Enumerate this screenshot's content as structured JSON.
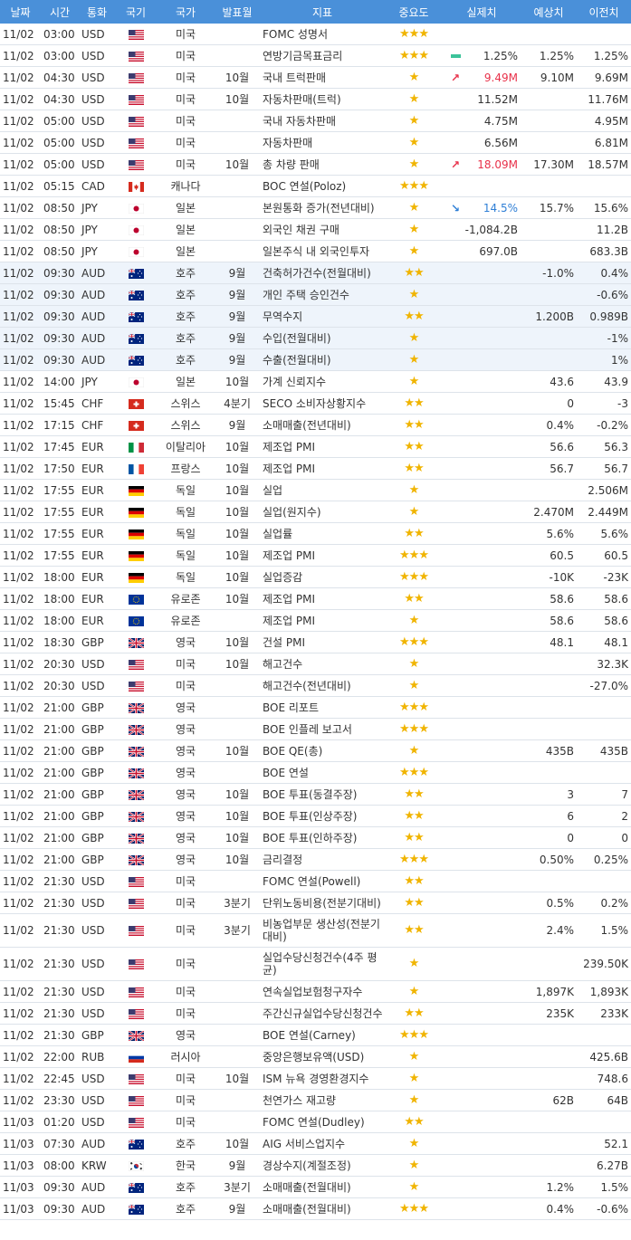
{
  "headers": [
    "날짜",
    "시간",
    "통화",
    "국기",
    "국가",
    "발표월",
    "지표",
    "중요도",
    "실제치",
    "예상치",
    "이전치"
  ],
  "colors": {
    "header": "#4a90d9",
    "star": "#f0b400",
    "up": "#e8314a",
    "down": "#2f7fd6",
    "flat": "#3cc39a"
  },
  "rows": [
    {
      "date": "11/02",
      "time": "03:00",
      "cur": "USD",
      "flag": "us-flag",
      "country": "미국",
      "month": "",
      "indicator": "FOMC 성명서",
      "stars": "★★★",
      "trend": "",
      "actual": "",
      "forecast": "",
      "previous": ""
    },
    {
      "date": "11/02",
      "time": "03:00",
      "cur": "USD",
      "flag": "us-flag",
      "country": "미국",
      "month": "",
      "indicator": "연방기금목표금리",
      "stars": "★★★",
      "trend": "flat",
      "actual": "1.25%",
      "forecast": "1.25%",
      "previous": "1.25%"
    },
    {
      "date": "11/02",
      "time": "04:30",
      "cur": "USD",
      "flag": "us-flag",
      "country": "미국",
      "month": "10월",
      "indicator": "국내 트럭판매",
      "stars": "★",
      "trend": "up",
      "actual": "9.49M",
      "forecast": "9.10M",
      "previous": "9.69M"
    },
    {
      "date": "11/02",
      "time": "04:30",
      "cur": "USD",
      "flag": "us-flag",
      "country": "미국",
      "month": "10월",
      "indicator": "자동차판매(트럭)",
      "stars": "★",
      "trend": "",
      "actual": "11.52M",
      "forecast": "",
      "previous": "11.76M"
    },
    {
      "date": "11/02",
      "time": "05:00",
      "cur": "USD",
      "flag": "us-flag",
      "country": "미국",
      "month": "",
      "indicator": "국내 자동차판매",
      "stars": "★",
      "trend": "",
      "actual": "4.75M",
      "forecast": "",
      "previous": "4.95M"
    },
    {
      "date": "11/02",
      "time": "05:00",
      "cur": "USD",
      "flag": "us-flag",
      "country": "미국",
      "month": "",
      "indicator": "자동차판매",
      "stars": "★",
      "trend": "",
      "actual": "6.56M",
      "forecast": "",
      "previous": "6.81M"
    },
    {
      "date": "11/02",
      "time": "05:00",
      "cur": "USD",
      "flag": "us-flag",
      "country": "미국",
      "month": "10월",
      "indicator": "총 차량 판매",
      "stars": "★",
      "trend": "up",
      "actual": "18.09M",
      "forecast": "17.30M",
      "previous": "18.57M"
    },
    {
      "date": "11/02",
      "time": "05:15",
      "cur": "CAD",
      "flag": "ca-flag",
      "country": "캐나다",
      "month": "",
      "indicator": "BOC 연설(Poloz)",
      "stars": "★★★",
      "trend": "",
      "actual": "",
      "forecast": "",
      "previous": ""
    },
    {
      "date": "11/02",
      "time": "08:50",
      "cur": "JPY",
      "flag": "jp-flag",
      "country": "일본",
      "month": "",
      "indicator": "본원통화 증가(전년대비)",
      "stars": "★",
      "trend": "down",
      "actual": "14.5%",
      "forecast": "15.7%",
      "previous": "15.6%"
    },
    {
      "date": "11/02",
      "time": "08:50",
      "cur": "JPY",
      "flag": "jp-flag",
      "country": "일본",
      "month": "",
      "indicator": "외국인 채권 구매",
      "stars": "★",
      "trend": "",
      "actual": "-1,084.2B",
      "forecast": "",
      "previous": "11.2B"
    },
    {
      "date": "11/02",
      "time": "08:50",
      "cur": "JPY",
      "flag": "jp-flag",
      "country": "일본",
      "month": "",
      "indicator": "일본주식 내 외국인투자",
      "stars": "★",
      "trend": "",
      "actual": "697.0B",
      "forecast": "",
      "previous": "683.3B"
    },
    {
      "date": "11/02",
      "time": "09:30",
      "cur": "AUD",
      "flag": "au-flag",
      "country": "호주",
      "month": "9월",
      "indicator": "건축허가건수(전월대비)",
      "stars": "★★",
      "trend": "",
      "actual": "",
      "forecast": "-1.0%",
      "previous": "0.4%",
      "hl": true
    },
    {
      "date": "11/02",
      "time": "09:30",
      "cur": "AUD",
      "flag": "au-flag",
      "country": "호주",
      "month": "9월",
      "indicator": "개인 주택 승인건수",
      "stars": "★",
      "trend": "",
      "actual": "",
      "forecast": "",
      "previous": "-0.6%",
      "hl": true
    },
    {
      "date": "11/02",
      "time": "09:30",
      "cur": "AUD",
      "flag": "au-flag",
      "country": "호주",
      "month": "9월",
      "indicator": "무역수지",
      "stars": "★★",
      "trend": "",
      "actual": "",
      "forecast": "1.200B",
      "previous": "0.989B",
      "hl": true
    },
    {
      "date": "11/02",
      "time": "09:30",
      "cur": "AUD",
      "flag": "au-flag",
      "country": "호주",
      "month": "9월",
      "indicator": "수입(전월대비)",
      "stars": "★",
      "trend": "",
      "actual": "",
      "forecast": "",
      "previous": "-1%",
      "hl": true
    },
    {
      "date": "11/02",
      "time": "09:30",
      "cur": "AUD",
      "flag": "au-flag",
      "country": "호주",
      "month": "9월",
      "indicator": "수출(전월대비)",
      "stars": "★",
      "trend": "",
      "actual": "",
      "forecast": "",
      "previous": "1%",
      "hl": true
    },
    {
      "date": "11/02",
      "time": "14:00",
      "cur": "JPY",
      "flag": "jp-flag",
      "country": "일본",
      "month": "10월",
      "indicator": "가계 신뢰지수",
      "stars": "★",
      "trend": "",
      "actual": "",
      "forecast": "43.6",
      "previous": "43.9"
    },
    {
      "date": "11/02",
      "time": "15:45",
      "cur": "CHF",
      "flag": "ch-flag",
      "country": "스위스",
      "month": "4분기",
      "indicator": "SECO 소비자상황지수",
      "stars": "★★",
      "trend": "",
      "actual": "",
      "forecast": "0",
      "previous": "-3"
    },
    {
      "date": "11/02",
      "time": "17:15",
      "cur": "CHF",
      "flag": "ch-flag",
      "country": "스위스",
      "month": "9월",
      "indicator": "소매매출(전년대비)",
      "stars": "★★",
      "trend": "",
      "actual": "",
      "forecast": "0.4%",
      "previous": "-0.2%"
    },
    {
      "date": "11/02",
      "time": "17:45",
      "cur": "EUR",
      "flag": "it-flag",
      "country": "이탈리아",
      "month": "10월",
      "indicator": "제조업 PMI",
      "stars": "★★",
      "trend": "",
      "actual": "",
      "forecast": "56.6",
      "previous": "56.3"
    },
    {
      "date": "11/02",
      "time": "17:50",
      "cur": "EUR",
      "flag": "fr-flag",
      "country": "프랑스",
      "month": "10월",
      "indicator": "제조업 PMI",
      "stars": "★★",
      "trend": "",
      "actual": "",
      "forecast": "56.7",
      "previous": "56.7"
    },
    {
      "date": "11/02",
      "time": "17:55",
      "cur": "EUR",
      "flag": "de-flag",
      "country": "독일",
      "month": "10월",
      "indicator": "실업",
      "stars": "★",
      "trend": "",
      "actual": "",
      "forecast": "",
      "previous": "2.506M"
    },
    {
      "date": "11/02",
      "time": "17:55",
      "cur": "EUR",
      "flag": "de-flag",
      "country": "독일",
      "month": "10월",
      "indicator": "실업(원지수)",
      "stars": "★",
      "trend": "",
      "actual": "",
      "forecast": "2.470M",
      "previous": "2.449M"
    },
    {
      "date": "11/02",
      "time": "17:55",
      "cur": "EUR",
      "flag": "de-flag",
      "country": "독일",
      "month": "10월",
      "indicator": "실업률",
      "stars": "★★",
      "trend": "",
      "actual": "",
      "forecast": "5.6%",
      "previous": "5.6%"
    },
    {
      "date": "11/02",
      "time": "17:55",
      "cur": "EUR",
      "flag": "de-flag",
      "country": "독일",
      "month": "10월",
      "indicator": "제조업 PMI",
      "stars": "★★★",
      "trend": "",
      "actual": "",
      "forecast": "60.5",
      "previous": "60.5"
    },
    {
      "date": "11/02",
      "time": "18:00",
      "cur": "EUR",
      "flag": "de-flag",
      "country": "독일",
      "month": "10월",
      "indicator": "실업증감",
      "stars": "★★★",
      "trend": "",
      "actual": "",
      "forecast": "-10K",
      "previous": "-23K"
    },
    {
      "date": "11/02",
      "time": "18:00",
      "cur": "EUR",
      "flag": "eu-flag",
      "country": "유로존",
      "month": "10월",
      "indicator": "제조업 PMI",
      "stars": "★★",
      "trend": "",
      "actual": "",
      "forecast": "58.6",
      "previous": "58.6"
    },
    {
      "date": "11/02",
      "time": "18:00",
      "cur": "EUR",
      "flag": "eu-flag",
      "country": "유로존",
      "month": "",
      "indicator": "제조업 PMI",
      "stars": "★",
      "trend": "",
      "actual": "",
      "forecast": "58.6",
      "previous": "58.6"
    },
    {
      "date": "11/02",
      "time": "18:30",
      "cur": "GBP",
      "flag": "gb-flag",
      "country": "영국",
      "month": "10월",
      "indicator": "건설 PMI",
      "stars": "★★★",
      "trend": "",
      "actual": "",
      "forecast": "48.1",
      "previous": "48.1"
    },
    {
      "date": "11/02",
      "time": "20:30",
      "cur": "USD",
      "flag": "us-flag",
      "country": "미국",
      "month": "10월",
      "indicator": "해고건수",
      "stars": "★",
      "trend": "",
      "actual": "",
      "forecast": "",
      "previous": "32.3K"
    },
    {
      "date": "11/02",
      "time": "20:30",
      "cur": "USD",
      "flag": "us-flag",
      "country": "미국",
      "month": "",
      "indicator": "해고건수(전년대비)",
      "stars": "★",
      "trend": "",
      "actual": "",
      "forecast": "",
      "previous": "-27.0%"
    },
    {
      "date": "11/02",
      "time": "21:00",
      "cur": "GBP",
      "flag": "gb-flag",
      "country": "영국",
      "month": "",
      "indicator": "BOE 리포트",
      "stars": "★★★",
      "trend": "",
      "actual": "",
      "forecast": "",
      "previous": ""
    },
    {
      "date": "11/02",
      "time": "21:00",
      "cur": "GBP",
      "flag": "gb-flag",
      "country": "영국",
      "month": "",
      "indicator": "BOE 인플레 보고서",
      "stars": "★★★",
      "trend": "",
      "actual": "",
      "forecast": "",
      "previous": ""
    },
    {
      "date": "11/02",
      "time": "21:00",
      "cur": "GBP",
      "flag": "gb-flag",
      "country": "영국",
      "month": "10월",
      "indicator": "BOE QE(총)",
      "stars": "★",
      "trend": "",
      "actual": "",
      "forecast": "435B",
      "previous": "435B"
    },
    {
      "date": "11/02",
      "time": "21:00",
      "cur": "GBP",
      "flag": "gb-flag",
      "country": "영국",
      "month": "",
      "indicator": "BOE 연설",
      "stars": "★★★",
      "trend": "",
      "actual": "",
      "forecast": "",
      "previous": ""
    },
    {
      "date": "11/02",
      "time": "21:00",
      "cur": "GBP",
      "flag": "gb-flag",
      "country": "영국",
      "month": "10월",
      "indicator": "BOE 투표(동결주장)",
      "stars": "★★",
      "trend": "",
      "actual": "",
      "forecast": "3",
      "previous": "7"
    },
    {
      "date": "11/02",
      "time": "21:00",
      "cur": "GBP",
      "flag": "gb-flag",
      "country": "영국",
      "month": "10월",
      "indicator": "BOE 투표(인상주장)",
      "stars": "★★",
      "trend": "",
      "actual": "",
      "forecast": "6",
      "previous": "2"
    },
    {
      "date": "11/02",
      "time": "21:00",
      "cur": "GBP",
      "flag": "gb-flag",
      "country": "영국",
      "month": "10월",
      "indicator": "BOE 투표(인하주장)",
      "stars": "★★",
      "trend": "",
      "actual": "",
      "forecast": "0",
      "previous": "0"
    },
    {
      "date": "11/02",
      "time": "21:00",
      "cur": "GBP",
      "flag": "gb-flag",
      "country": "영국",
      "month": "10월",
      "indicator": "금리결정",
      "stars": "★★★",
      "trend": "",
      "actual": "",
      "forecast": "0.50%",
      "previous": "0.25%"
    },
    {
      "date": "11/02",
      "time": "21:30",
      "cur": "USD",
      "flag": "us-flag",
      "country": "미국",
      "month": "",
      "indicator": "FOMC 연설(Powell)",
      "stars": "★★",
      "trend": "",
      "actual": "",
      "forecast": "",
      "previous": ""
    },
    {
      "date": "11/02",
      "time": "21:30",
      "cur": "USD",
      "flag": "us-flag",
      "country": "미국",
      "month": "3분기",
      "indicator": "단위노동비용(전분기대비)",
      "stars": "★★",
      "trend": "",
      "actual": "",
      "forecast": "0.5%",
      "previous": "0.2%"
    },
    {
      "date": "11/02",
      "time": "21:30",
      "cur": "USD",
      "flag": "us-flag",
      "country": "미국",
      "month": "3분기",
      "indicator": "비농업부문 생산성(전분기대비)",
      "stars": "★★",
      "trend": "",
      "actual": "",
      "forecast": "2.4%",
      "previous": "1.5%",
      "tall": true
    },
    {
      "date": "11/02",
      "time": "21:30",
      "cur": "USD",
      "flag": "us-flag",
      "country": "미국",
      "month": "",
      "indicator": "실업수당신청건수(4주 평균)",
      "stars": "★",
      "trend": "",
      "actual": "",
      "forecast": "",
      "previous": "239.50K",
      "tall": true
    },
    {
      "date": "11/02",
      "time": "21:30",
      "cur": "USD",
      "flag": "us-flag",
      "country": "미국",
      "month": "",
      "indicator": "연속실업보험청구자수",
      "stars": "★",
      "trend": "",
      "actual": "",
      "forecast": "1,897K",
      "previous": "1,893K"
    },
    {
      "date": "11/02",
      "time": "21:30",
      "cur": "USD",
      "flag": "us-flag",
      "country": "미국",
      "month": "",
      "indicator": "주간신규실업수당신청건수",
      "stars": "★★",
      "trend": "",
      "actual": "",
      "forecast": "235K",
      "previous": "233K"
    },
    {
      "date": "11/02",
      "time": "21:30",
      "cur": "GBP",
      "flag": "gb-flag",
      "country": "영국",
      "month": "",
      "indicator": "BOE 연설(Carney)",
      "stars": "★★★",
      "trend": "",
      "actual": "",
      "forecast": "",
      "previous": ""
    },
    {
      "date": "11/02",
      "time": "22:00",
      "cur": "RUB",
      "flag": "ru-flag",
      "country": "러시아",
      "month": "",
      "indicator": "중앙은행보유액(USD)",
      "stars": "★",
      "trend": "",
      "actual": "",
      "forecast": "",
      "previous": "425.6B"
    },
    {
      "date": "11/02",
      "time": "22:45",
      "cur": "USD",
      "flag": "us-flag",
      "country": "미국",
      "month": "10월",
      "indicator": "ISM 뉴욕 경영환경지수",
      "stars": "★",
      "trend": "",
      "actual": "",
      "forecast": "",
      "previous": "748.6"
    },
    {
      "date": "11/02",
      "time": "23:30",
      "cur": "USD",
      "flag": "us-flag",
      "country": "미국",
      "month": "",
      "indicator": "천연가스 재고량",
      "stars": "★",
      "trend": "",
      "actual": "",
      "forecast": "62B",
      "previous": "64B"
    },
    {
      "date": "11/03",
      "time": "01:20",
      "cur": "USD",
      "flag": "us-flag",
      "country": "미국",
      "month": "",
      "indicator": "FOMC 연설(Dudley)",
      "stars": "★★",
      "trend": "",
      "actual": "",
      "forecast": "",
      "previous": ""
    },
    {
      "date": "11/03",
      "time": "07:30",
      "cur": "AUD",
      "flag": "au-flag",
      "country": "호주",
      "month": "10월",
      "indicator": "AIG 서비스업지수",
      "stars": "★",
      "trend": "",
      "actual": "",
      "forecast": "",
      "previous": "52.1"
    },
    {
      "date": "11/03",
      "time": "08:00",
      "cur": "KRW",
      "flag": "kr-flag",
      "country": "한국",
      "month": "9월",
      "indicator": "경상수지(계절조정)",
      "stars": "★",
      "trend": "",
      "actual": "",
      "forecast": "",
      "previous": "6.27B"
    },
    {
      "date": "11/03",
      "time": "09:30",
      "cur": "AUD",
      "flag": "au-flag",
      "country": "호주",
      "month": "3분기",
      "indicator": "소매매출(전월대비)",
      "stars": "★",
      "trend": "",
      "actual": "",
      "forecast": "1.2%",
      "previous": "1.5%"
    },
    {
      "date": "11/03",
      "time": "09:30",
      "cur": "AUD",
      "flag": "au-flag",
      "country": "호주",
      "month": "9월",
      "indicator": "소매매출(전월대비)",
      "stars": "★★★",
      "trend": "",
      "actual": "",
      "forecast": "0.4%",
      "previous": "-0.6%"
    }
  ]
}
